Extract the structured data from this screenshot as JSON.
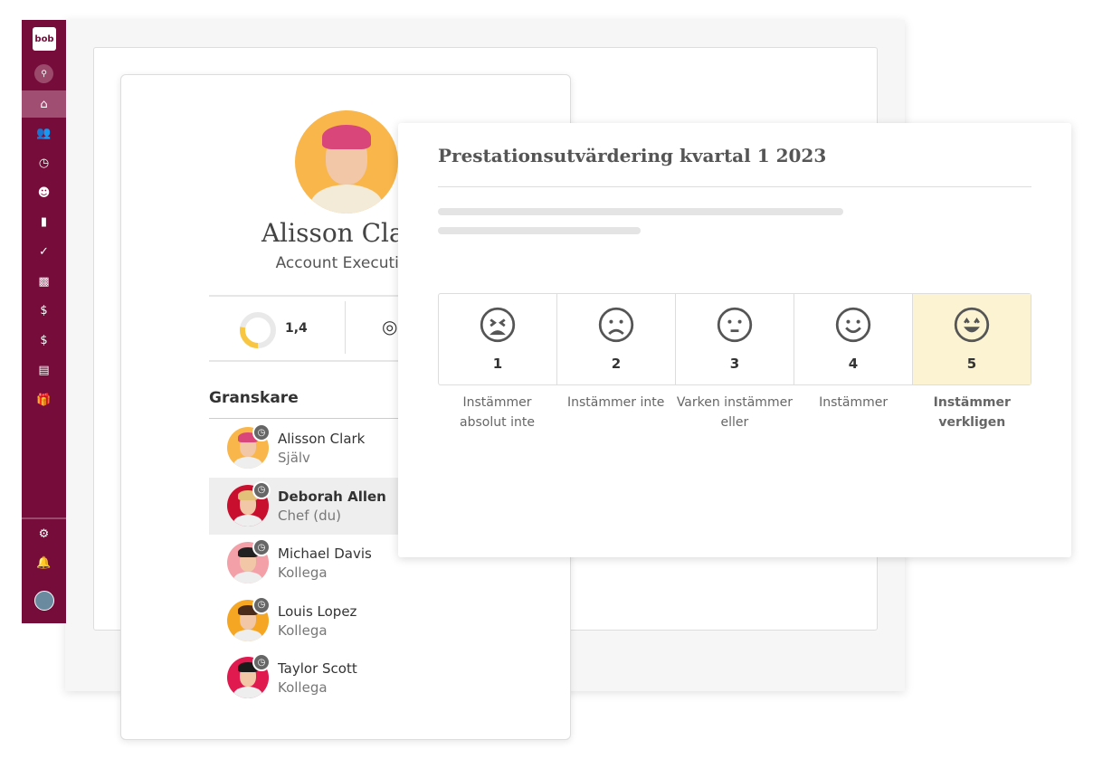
{
  "sidebar": {
    "logo": "bob",
    "items": [
      "home-icon",
      "people-icon",
      "clock-icon",
      "user-circle-icon",
      "document-icon",
      "clipboard-check-icon",
      "bar-chart-icon",
      "dollar-icon",
      "calendar-dollar-icon",
      "desk-icon",
      "gift-icon"
    ],
    "active": "home",
    "bottom": [
      "gear-icon",
      "bell-icon",
      "avatar"
    ]
  },
  "profile": {
    "name": "Alisson Clark",
    "title": "Account Executive",
    "stat_value": "1,4",
    "stat_fraction": 0.28,
    "reviewers_heading": "Granskare",
    "reviewers": [
      {
        "name": "Alisson Clark",
        "role": "Själv",
        "color": "#f9b64a",
        "hair": "#d9477a"
      },
      {
        "name": "Deborah Allen",
        "role": "Chef (du)",
        "color": "#c8102e",
        "hair": "#e3c07a",
        "selected": true
      },
      {
        "name": "Michael Davis",
        "role": "Kollega",
        "color": "#f4a0a8",
        "hair": "#222"
      },
      {
        "name": "Louis Lopez",
        "role": "Kollega",
        "color": "#f5a623",
        "hair": "#4a2a18"
      },
      {
        "name": "Taylor Scott",
        "role": "Kollega",
        "color": "#e0194f",
        "hair": "#1a1a1a"
      }
    ]
  },
  "review": {
    "title": "Prestationsutvärdering kvartal 1 2023",
    "options": [
      {
        "value": "1",
        "label": "Instämmer absolut inte",
        "icon": "tired-face-icon"
      },
      {
        "value": "2",
        "label": "Instämmer inte",
        "icon": "frown-face-icon"
      },
      {
        "value": "3",
        "label": "Varken instämmer eller",
        "icon": "neutral-face-icon"
      },
      {
        "value": "4",
        "label": "Instämmer",
        "icon": "smile-face-icon"
      },
      {
        "value": "5",
        "label": "Instämmer verkligen",
        "icon": "grin-face-icon",
        "selected": true
      }
    ]
  },
  "colors": {
    "sidebar": "#760c3a",
    "selected_option": "#fcf3d2",
    "donut": "#f9c642"
  }
}
